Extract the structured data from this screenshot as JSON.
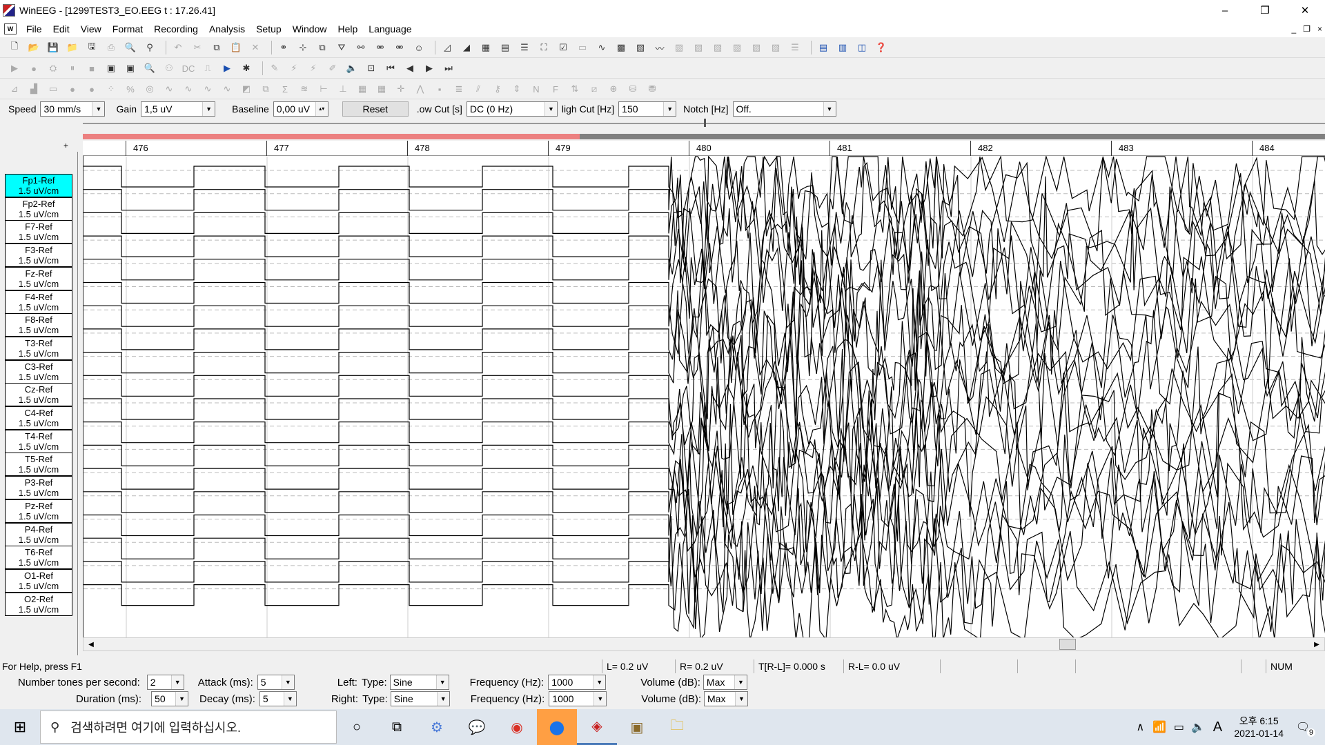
{
  "window": {
    "title": "WinEEG - [1299TEST3_EO.EEG t : 17.26.41]",
    "controls": [
      "–",
      "❐",
      "✕"
    ]
  },
  "menu": {
    "mdi_icon": "W",
    "items": [
      "File",
      "Edit",
      "View",
      "Format",
      "Recording",
      "Analysis",
      "Setup",
      "Window",
      "Help",
      "Language"
    ],
    "mdi_controls": [
      "_",
      "❐",
      "×"
    ]
  },
  "settings": {
    "speed_label": "Speed",
    "speed_value": "30 mm/s",
    "gain_label": "Gain",
    "gain_value": "1,5 uV",
    "baseline_label": "Baseline",
    "baseline_value": "0,00 uV",
    "reset_label": "Reset",
    "lowcut_label": ".ow Cut [s]",
    "lowcut_value": "DC    (0 Hz)",
    "highcut_label": "ligh Cut [Hz]",
    "highcut_value": "150",
    "notch_label": "Notch [Hz]",
    "notch_value": "Off."
  },
  "progress": {
    "fraction": 0.4
  },
  "time_ticks": [
    "476",
    "477",
    "478",
    "479",
    "480",
    "481",
    "482",
    "483",
    "484"
  ],
  "channels": [
    {
      "name": "Fp1-Ref",
      "scale": "1.5 uV/cm"
    },
    {
      "name": "Fp2-Ref",
      "scale": "1.5 uV/cm"
    },
    {
      "name": "F7-Ref",
      "scale": "1.5 uV/cm"
    },
    {
      "name": "F3-Ref",
      "scale": "1.5 uV/cm"
    },
    {
      "name": "Fz-Ref",
      "scale": "1.5 uV/cm"
    },
    {
      "name": "F4-Ref",
      "scale": "1.5 uV/cm"
    },
    {
      "name": "F8-Ref",
      "scale": "1.5 uV/cm"
    },
    {
      "name": "T3-Ref",
      "scale": "1.5 uV/cm"
    },
    {
      "name": "C3-Ref",
      "scale": "1.5 uV/cm"
    },
    {
      "name": "Cz-Ref",
      "scale": "1.5 uV/cm"
    },
    {
      "name": "C4-Ref",
      "scale": "1.5 uV/cm"
    },
    {
      "name": "T4-Ref",
      "scale": "1.5 uV/cm"
    },
    {
      "name": "T5-Ref",
      "scale": "1.5 uV/cm"
    },
    {
      "name": "P3-Ref",
      "scale": "1.5 uV/cm"
    },
    {
      "name": "Pz-Ref",
      "scale": "1.5 uV/cm"
    },
    {
      "name": "P4-Ref",
      "scale": "1.5 uV/cm"
    },
    {
      "name": "T6-Ref",
      "scale": "1.5 uV/cm"
    },
    {
      "name": "O1-Ref",
      "scale": "1.5 uV/cm"
    },
    {
      "name": "O2-Ref",
      "scale": "1.5 uV/cm"
    }
  ],
  "status": {
    "help": "For Help, press F1",
    "left": "L=    0.2 uV",
    "right": "R=    0.2 uV",
    "trl": "T[R-L]= 0.000 s",
    "rl": "R-L=      0.0 uV",
    "num": "NUM"
  },
  "tones": {
    "tones_label": "Number tones per second:",
    "tones_value": "2",
    "attack_label": "Attack (ms):",
    "attack_value": "5",
    "duration_label": "Duration (ms):",
    "duration_value": "50",
    "decay_label": "Decay (ms):",
    "decay_value": "5",
    "left_label": "Left:",
    "right_label": "Right:",
    "type_label": "Type:",
    "left_type": "Sine",
    "right_type": "Sine",
    "freq_label": "Frequency (Hz):",
    "left_freq": "1000",
    "right_freq": "1000",
    "vol_label": "Volume (dB):",
    "left_vol": "Max",
    "right_vol": "Max"
  },
  "taskbar": {
    "search_placeholder": "검색하려면 여기에 입력하십시오.",
    "time": "오후 6:15",
    "date": "2021-01-14",
    "notification_count": "9",
    "ime": "A"
  }
}
